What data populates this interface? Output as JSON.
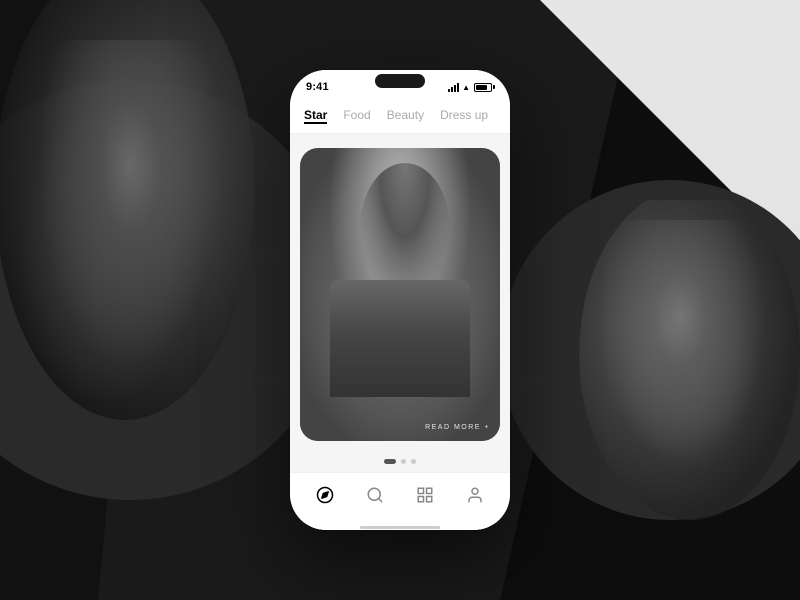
{
  "background": {
    "leftFaceDesc": "person wearing cap, dark background",
    "rightFaceDesc": "bald person, dark background"
  },
  "phone": {
    "statusBar": {
      "time": "9:41"
    },
    "tabs": [
      {
        "label": "Star",
        "active": true
      },
      {
        "label": "Food",
        "active": false
      },
      {
        "label": "Beauty",
        "active": false
      },
      {
        "label": "Dress up",
        "active": false
      }
    ],
    "card": {
      "readMoreLabel": "READ MORE +"
    },
    "bottomNav": [
      {
        "icon": "compass",
        "label": "explore",
        "active": true
      },
      {
        "icon": "search",
        "label": "search",
        "active": false
      },
      {
        "icon": "grid",
        "label": "grid",
        "active": false
      },
      {
        "icon": "person",
        "label": "profile",
        "active": false
      }
    ],
    "dots": [
      {
        "active": true
      },
      {
        "active": false
      },
      {
        "active": false
      }
    ]
  }
}
